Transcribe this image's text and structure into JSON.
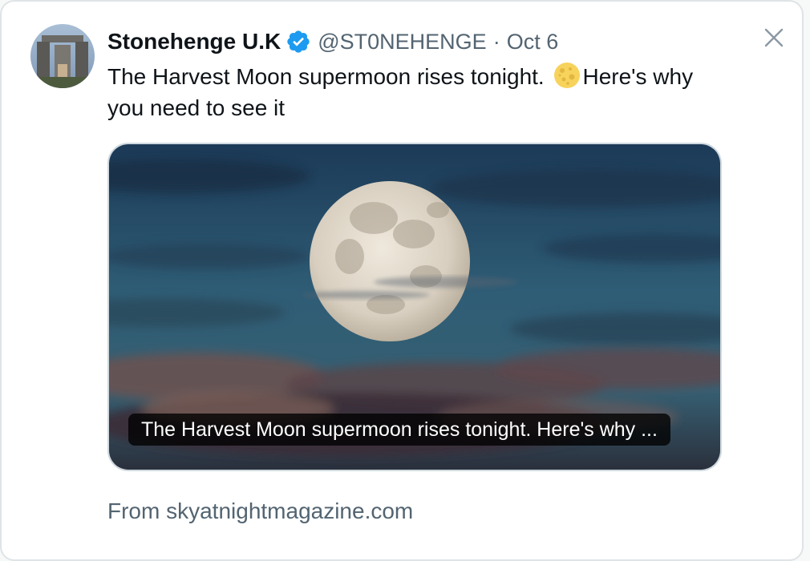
{
  "author": {
    "display_name": "Stonehenge U.K",
    "handle": "@ST0NEHENGE",
    "separator": "·",
    "date": "Oct 6",
    "verified_color": "#1d9bf0"
  },
  "tweet": {
    "text_before_emoji": "The Harvest Moon supermoon rises tonight. ",
    "emoji_icon": "full-moon-emoji",
    "text_after_emoji": "Here's why you need to see it"
  },
  "card": {
    "caption": "The Harvest Moon supermoon rises tonight. Here's why ...",
    "source": "From skyatnightmagazine.com"
  },
  "icons": {
    "close": "close-icon",
    "verified": "verified-badge-icon"
  },
  "colors": {
    "text_primary": "#0f1419",
    "text_secondary": "#536471",
    "border": "#cfd9de"
  }
}
